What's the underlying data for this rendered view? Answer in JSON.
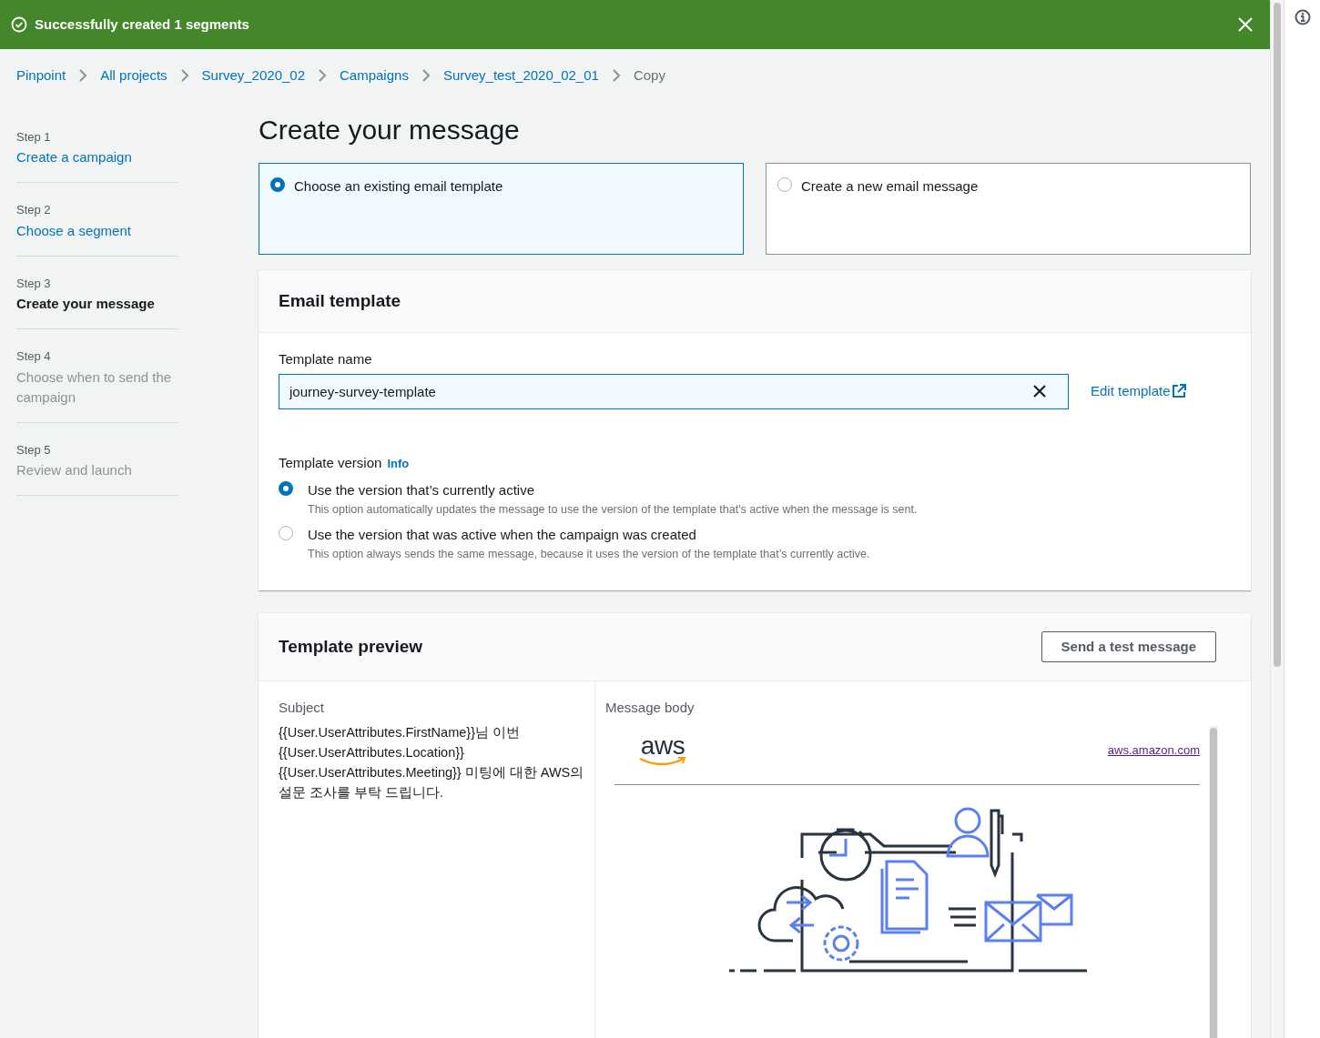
{
  "flash": {
    "message": "Successfully created 1 segments"
  },
  "breadcrumbs": [
    {
      "label": "Pinpoint",
      "kind": "link"
    },
    {
      "label": "All projects",
      "kind": "link"
    },
    {
      "label": "Survey_2020_02",
      "kind": "link"
    },
    {
      "label": "Campaigns",
      "kind": "link"
    },
    {
      "label": "Survey_test_2020_02_01",
      "kind": "link"
    },
    {
      "label": "Copy",
      "kind": "current"
    }
  ],
  "steps": [
    {
      "step": "Step 1",
      "title": "Create a campaign",
      "kind": "link"
    },
    {
      "step": "Step 2",
      "title": "Choose a segment",
      "kind": "link"
    },
    {
      "step": "Step 3",
      "title": "Create your message",
      "kind": "current"
    },
    {
      "step": "Step 4",
      "title": "Choose when to send the campaign",
      "kind": "upcoming"
    },
    {
      "step": "Step 5",
      "title": "Review and launch",
      "kind": "upcoming"
    }
  ],
  "page_title": "Create your message",
  "message_options": [
    {
      "label": "Choose an existing email template",
      "selected": true
    },
    {
      "label": "Create a new email message",
      "selected": false
    }
  ],
  "email_template": {
    "title": "Email template",
    "field_label": "Template name",
    "value": "journey-survey-template",
    "edit_link": "Edit template",
    "version_label": "Template version",
    "info": "Info",
    "versions": [
      {
        "label": "Use the version that’s currently active",
        "description": "This option automatically updates the message to use the version of the template that's active when the message is sent.",
        "selected": true
      },
      {
        "label": "Use the version that was active when the campaign was created",
        "description": "This option always sends the same message, because it uses the version of the template that’s currently active.",
        "selected": false
      }
    ]
  },
  "preview": {
    "title": "Template preview",
    "button": "Send a test message",
    "subject_label": "Subject",
    "subject": "{{User.UserAttributes.FirstName}}님 이번 {{User.UserAttributes.Location}} {{User.UserAttributes.Meeting}} 미팅에 대한 AWS의 설문 조사를 부탁 드립니다.",
    "body_label": "Message body",
    "logo_text": "aws",
    "link": "aws.amazon.com"
  }
}
